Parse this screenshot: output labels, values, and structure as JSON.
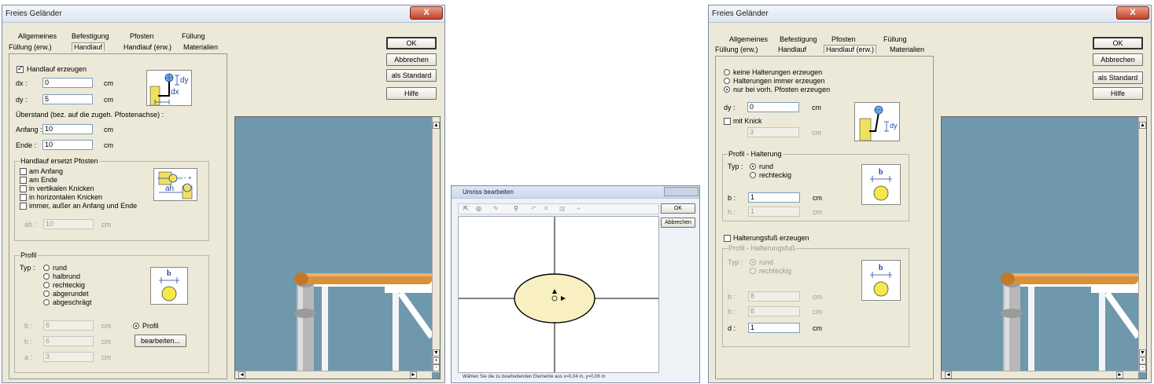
{
  "dialog1": {
    "title": "Freies Geländer",
    "close": "X",
    "tabs_row1": [
      "Allgemeines",
      "Befestigung",
      "Pfosten",
      "Füllung"
    ],
    "tabs_row2": [
      "Füllung (erw.)",
      "Handlauf",
      "Handlauf (erw.)",
      "Materialien"
    ],
    "active_tab": "Handlauf",
    "buttons": {
      "ok": "OK",
      "cancel": "Abbrechen",
      "default": "als Standard",
      "help": "Hilfe"
    },
    "handlauf_checkbox": "Handlauf erzeugen",
    "dx_label": "dx :",
    "dx_value": "0",
    "dx_unit": "cm",
    "dy_label": "dy :",
    "dy_value": "5",
    "dy_unit": "cm",
    "ueberstand_label": "Überstand (bez. auf die zugeh. Pfostenachse) :",
    "anfang_label": "Anfang :",
    "anfang_value": "10",
    "anfang_unit": "cm",
    "ende_label": "Ende :",
    "ende_value": "10",
    "ende_unit": "cm",
    "group_ersetzt": {
      "legend": "Handlauf ersetzt Pfosten",
      "options": [
        "am Anfang",
        "am Ende",
        "in vertikalen Knicken",
        "in horizontalen Knicken",
        "immer, außer an Anfang und Ende"
      ],
      "ah_label": "ah :",
      "ah_value": "10",
      "ah_unit": "cm"
    },
    "group_profil": {
      "legend": "Profil",
      "typ_label": "Typ :",
      "types": [
        "rund",
        "halbrund",
        "rechteckig",
        "abgerundet",
        "abgeschrägt"
      ],
      "b_label": "b :",
      "b_value": "6",
      "b_unit": "cm",
      "h_label": "h :",
      "h_value": "6",
      "h_unit": "cm",
      "a_label": "a :",
      "a_value": "3",
      "a_unit": "cm",
      "profil_radio": "Profil",
      "bearbeiten": "bearbeiten..."
    },
    "icon_labels": {
      "dy": "dy",
      "dx": "dx",
      "ah": "ah",
      "b": "b"
    }
  },
  "dialog2": {
    "title": "Umriss bearbeiten",
    "ok": "OK",
    "cancel": "Abbrechen",
    "status": "Wählen Sie die zu bearbeitenden Elemente aus   x=0,04 m, y=0,06 m"
  },
  "dialog3": {
    "title": "Freies Geländer",
    "close": "X",
    "tabs_row1": [
      "Allgemeines",
      "Befestigung",
      "Pfosten",
      "Füllung"
    ],
    "tabs_row2": [
      "Füllung (erw.)",
      "Handlauf",
      "Handlauf (erw.)",
      "Materialien"
    ],
    "active_tab": "Handlauf (erw.)",
    "buttons": {
      "ok": "OK",
      "cancel": "Abbrechen",
      "default": "als Standard",
      "help": "Hilfe"
    },
    "halterung_options": [
      "keine Halterungen erzeugen",
      "Halterungen immer erzeugen",
      "nur bei vorh. Pfosten erzeugen"
    ],
    "dy_label": "dy :",
    "dy_value": "0",
    "dy_unit": "cm",
    "knick_checkbox": "mit Knick",
    "knick_value": "3",
    "knick_unit": "cm",
    "group_halterung": {
      "legend": "Profil - Halterung",
      "typ_label": "Typ :",
      "types": [
        "rund",
        "rechteckig"
      ],
      "b_label": "b :",
      "b_value": "1",
      "b_unit": "cm",
      "h_label": "h :",
      "h_value": "1",
      "h_unit": "cm"
    },
    "fuss_checkbox": "Halterungsfuß erzeugen",
    "group_fuss": {
      "legend": "Profil - Halterungsfuß",
      "typ_label": "Typ :",
      "types": [
        "rund",
        "rechteckig"
      ],
      "b_label": "b :",
      "b_value": "8",
      "b_unit": "cm",
      "h_label": "h :",
      "h_value": "8",
      "h_unit": "cm",
      "d_label": "d :",
      "d_value": "1",
      "d_unit": "cm"
    },
    "icon_labels": {
      "dy": "dy",
      "b": "b"
    }
  },
  "colors": {
    "preview_bg": "#6f98ad",
    "handrail": "#d9903a",
    "ellipse_fill": "#f8f0c0"
  }
}
